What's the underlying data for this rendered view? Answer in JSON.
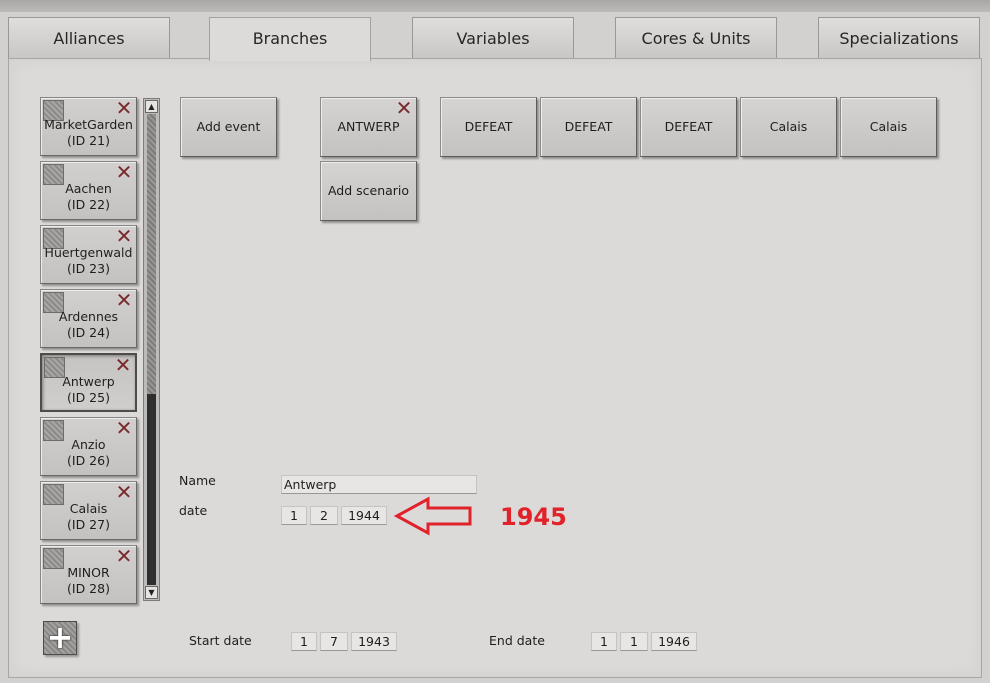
{
  "tabs": [
    {
      "label": "Alliances",
      "active": false
    },
    {
      "label": "Branches",
      "active": true
    },
    {
      "label": "Variables",
      "active": false
    },
    {
      "label": "Cores & Units",
      "active": false
    },
    {
      "label": "Specializations",
      "active": false
    }
  ],
  "scenarios": [
    {
      "name": "MarketGarden",
      "id": "(ID 21)"
    },
    {
      "name": "Aachen",
      "id": "(ID 22)"
    },
    {
      "name": "Huertgenwald",
      "id": "(ID 23)"
    },
    {
      "name": "Ardennes",
      "id": "(ID 24)"
    },
    {
      "name": "Antwerp",
      "id": "(ID 25)",
      "selected": true
    },
    {
      "name": "Anzio",
      "id": "(ID 26)"
    },
    {
      "name": "Calais",
      "id": "(ID 27)"
    },
    {
      "name": "MINOR",
      "id": "(ID 28)"
    }
  ],
  "buttons": {
    "add_event": "Add event",
    "add_scenario": "Add scenario",
    "current": "ANTWERP",
    "branches": [
      "DEFEAT",
      "DEFEAT",
      "DEFEAT",
      "Calais",
      "Calais"
    ]
  },
  "form": {
    "name_label": "Name",
    "name_value": "Antwerp",
    "date_label": "date",
    "date": {
      "day": "1",
      "month": "2",
      "year": "1944"
    },
    "start_label": "Start date",
    "start": {
      "day": "1",
      "month": "7",
      "year": "1943"
    },
    "end_label": "End date",
    "end": {
      "day": "1",
      "month": "1",
      "year": "1946"
    }
  },
  "annotation": {
    "text": "1945",
    "color": "#e0222b"
  },
  "icons": {
    "delete": "close-x-icon",
    "add": "plus-icon",
    "scroll_up": "arrow-up-icon",
    "scroll_down": "arrow-down-icon"
  }
}
